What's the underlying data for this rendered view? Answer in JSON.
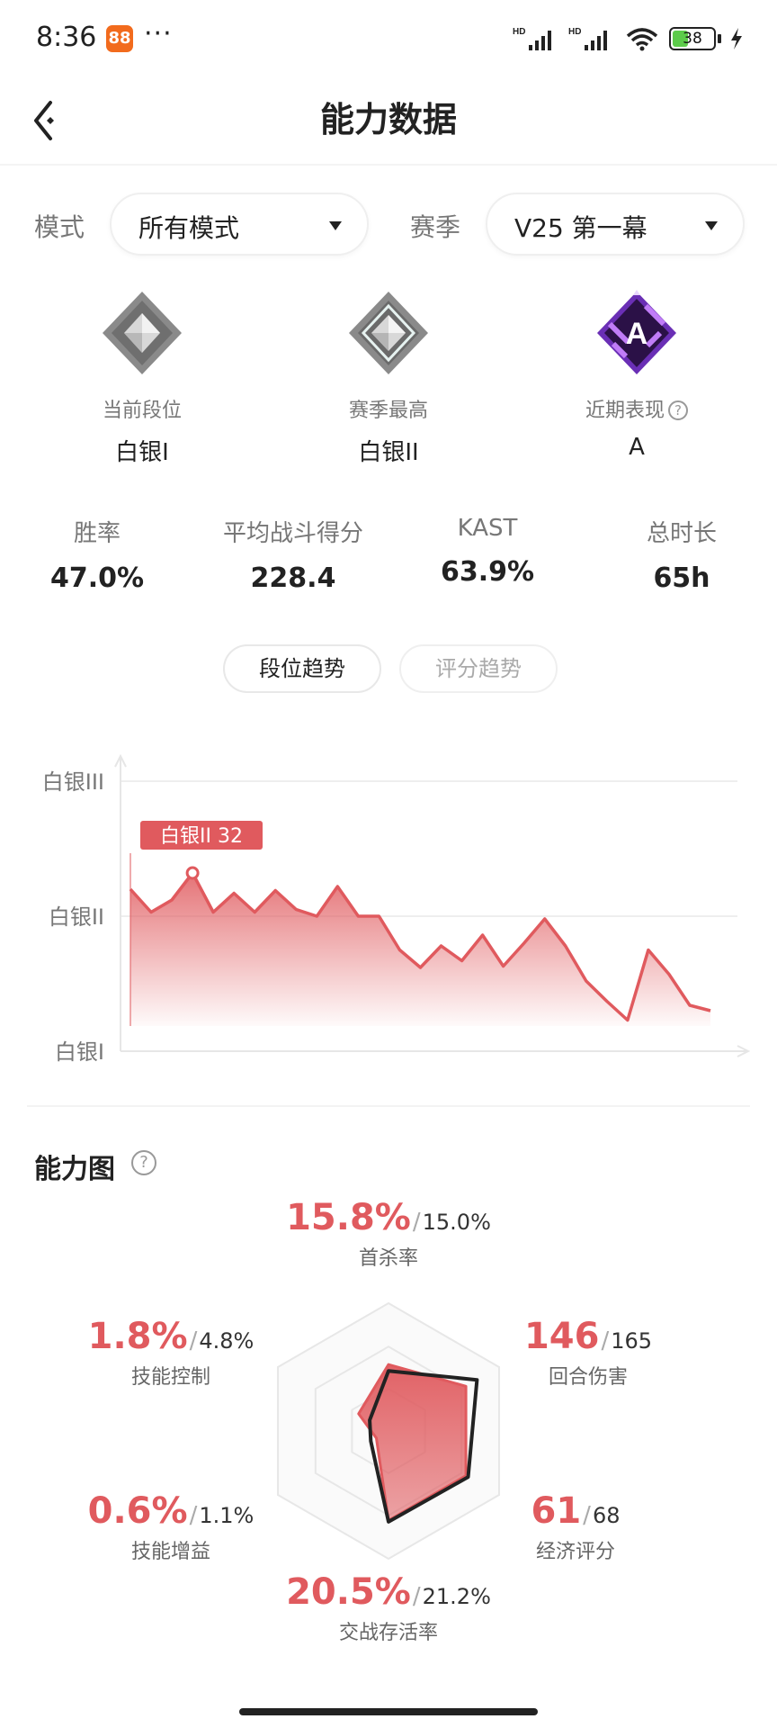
{
  "status_bar": {
    "time": "8:36",
    "app_badge_glyph": "88",
    "battery": "38",
    "battery_fraction": 0.38
  },
  "header": {
    "title": "能力数据"
  },
  "filters": {
    "mode_label": "模式",
    "mode_value": "所有模式",
    "season_label": "赛季",
    "season_value": "V25 第一幕"
  },
  "ranks": [
    {
      "label": "当前段位",
      "value": "白银I",
      "icon": "silver-1-rank-icon"
    },
    {
      "label": "赛季最高",
      "value": "白银II",
      "icon": "silver-2-rank-icon"
    },
    {
      "label": "近期表现",
      "value": "A",
      "icon": "grade-a-icon"
    }
  ],
  "stats": [
    {
      "label": "胜率",
      "value": "47.0%"
    },
    {
      "label": "平均战斗得分",
      "value": "228.4"
    },
    {
      "label": "KAST",
      "value": "63.9%"
    },
    {
      "label": "总时长",
      "value": "65h"
    }
  ],
  "trend_tabs": [
    {
      "label": "段位趋势",
      "active": true
    },
    {
      "label": "评分趋势",
      "active": false
    }
  ],
  "chart_data": {
    "type": "area",
    "title": "",
    "y_ticks": [
      "白银I",
      "白银II",
      "白银III"
    ],
    "ylim": [
      0,
      200
    ],
    "values": [
      120,
      103,
      112,
      132,
      103,
      117,
      103,
      119,
      105,
      100,
      122,
      100,
      100,
      75,
      62,
      78,
      67,
      86,
      63,
      80,
      98,
      78,
      52,
      37,
      23,
      75,
      57,
      34,
      30
    ],
    "highlight": {
      "index": 3,
      "label": "白银II 32"
    },
    "color": "#e05a5e"
  },
  "radar": {
    "title": "能力图",
    "metrics": [
      {
        "name": "首杀率",
        "value": "15.8%",
        "avg": "15.0%"
      },
      {
        "name": "回合伤害",
        "value": "146",
        "avg": "165"
      },
      {
        "name": "经济评分",
        "value": "61",
        "avg": "68"
      },
      {
        "name": "交战存活率",
        "value": "20.5%",
        "avg": "21.2%"
      },
      {
        "name": "技能增益",
        "value": "0.6%",
        "avg": "1.1%"
      },
      {
        "name": "技能控制",
        "value": "1.8%",
        "avg": "4.8%"
      }
    ],
    "player_levels": [
      0.52,
      0.7,
      0.7,
      0.7,
      0.11,
      0.27
    ],
    "average_levels": [
      0.47,
      0.8,
      0.72,
      0.71,
      0.16,
      0.17
    ],
    "player_color": "#e05a5e",
    "average_color": "#222222"
  }
}
